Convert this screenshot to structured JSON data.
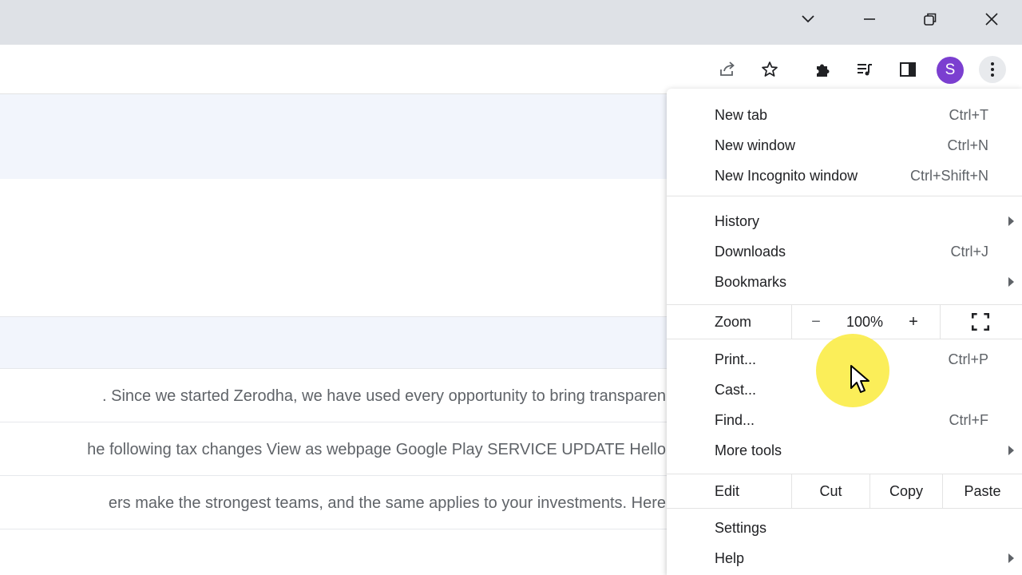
{
  "window": {
    "controls": [
      "chevron-down",
      "minimize",
      "restore",
      "close"
    ]
  },
  "toolbar": {
    "avatar_letter": "S",
    "icons": [
      "share-icon",
      "star-icon",
      "extensions-icon",
      "media-icon",
      "side-panel-icon",
      "more-vert-icon"
    ]
  },
  "emails": [
    {
      "snippet": ". Since we started Zerodha, we have used every opportunity to bring transparen"
    },
    {
      "snippet": "he following tax changes View as webpage Google Play SERVICE UPDATE Hello"
    },
    {
      "snippet": "ers make the strongest teams, and the same applies to your investments. Here"
    }
  ],
  "menu": {
    "new_tab": {
      "label": "New tab",
      "shortcut": "Ctrl+T"
    },
    "new_window": {
      "label": "New window",
      "shortcut": "Ctrl+N"
    },
    "new_incognito": {
      "label": "New Incognito window",
      "shortcut": "Ctrl+Shift+N"
    },
    "history": {
      "label": "History"
    },
    "downloads": {
      "label": "Downloads",
      "shortcut": "Ctrl+J"
    },
    "bookmarks": {
      "label": "Bookmarks"
    },
    "zoom": {
      "label": "Zoom",
      "minus": "−",
      "value": "100%",
      "plus": "+"
    },
    "print": {
      "label": "Print...",
      "shortcut": "Ctrl+P"
    },
    "cast": {
      "label": "Cast..."
    },
    "find": {
      "label": "Find...",
      "shortcut": "Ctrl+F"
    },
    "more_tools": {
      "label": "More tools"
    },
    "edit": {
      "label": "Edit",
      "cut": "Cut",
      "copy": "Copy",
      "paste": "Paste"
    },
    "settings": {
      "label": "Settings"
    },
    "help": {
      "label": "Help"
    }
  },
  "colors": {
    "titlebar": "#dee1e6",
    "avatar": "#7b3fd0",
    "highlight": "#faeb3c"
  }
}
